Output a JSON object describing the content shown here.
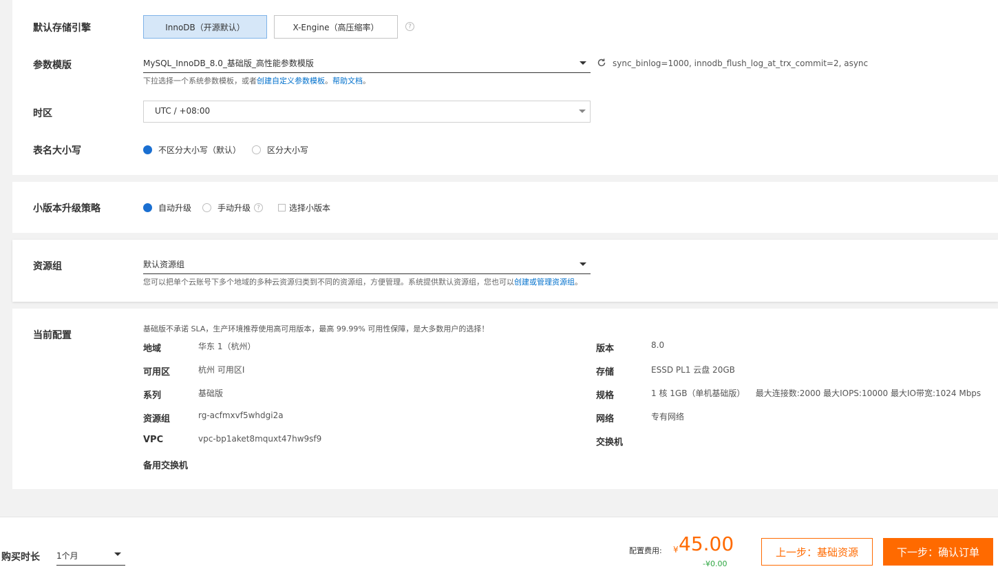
{
  "storage_engine": {
    "label": "默认存储引擎",
    "options": [
      "InnoDB（开源默认）",
      "X-Engine（高压缩率）"
    ],
    "selected": 0
  },
  "param_template": {
    "label": "参数模版",
    "value": "MySQL_InnoDB_8.0_基础版_高性能参数模版",
    "summary": "sync_binlog=1000, innodb_flush_log_at_trx_commit=2, async",
    "hint_prefix": "下拉选择一个系统参数模板，或者",
    "hint_link1": "创建自定义参数模板",
    "hint_sep": "。",
    "hint_link2": "帮助文档",
    "hint_end": "。"
  },
  "timezone": {
    "label": "时区",
    "value": "UTC / +08:00"
  },
  "table_case": {
    "label": "表名大小写",
    "options": [
      "不区分大小写（默认）",
      "区分大小写"
    ],
    "selected": 0
  },
  "minor_upgrade": {
    "label": "小版本升级策略",
    "options": [
      "自动升级",
      "手动升级"
    ],
    "selected": 0,
    "checkbox_label": "选择小版本"
  },
  "resource_group": {
    "label": "资源组",
    "value": "默认资源组",
    "hint_prefix": "您可以把单个云账号下多个地域的多种云资源归类到不同的资源组，方便管理。系统提供默认资源组，您也可以",
    "hint_link": "创建或管理资源组",
    "hint_end": "。"
  },
  "current_config": {
    "label": "当前配置",
    "notice": "基础版不承诺 SLA，生产环境推荐使用高可用版本，最高 99.99% 可用性保障，是大多数用户的选择！",
    "left": [
      {
        "k": "地域",
        "v": "华东 1（杭州）"
      },
      {
        "k": "可用区",
        "v": "杭州 可用区I"
      },
      {
        "k": "系列",
        "v": "基础版"
      },
      {
        "k": "资源组",
        "v": "rg-acfmxvf5whdgi2a"
      },
      {
        "k": "VPC",
        "v": "vpc-bp1aket8mquxt47hw9sf9"
      },
      {
        "k": "备用交换机",
        "v": ""
      }
    ],
    "right": [
      {
        "k": "版本",
        "v": "8.0"
      },
      {
        "k": "存储",
        "v": "ESSD PL1 云盘 20GB"
      },
      {
        "k": "规格",
        "v": "1 核 1GB（单机基础版）    最大连接数:2000 最大IOPS:10000 最大IO带宽:1024 Mbps"
      },
      {
        "k": "网络",
        "v": "专有网络"
      },
      {
        "k": "交换机",
        "v": ""
      }
    ]
  },
  "footer": {
    "duration_label": "购买时长",
    "duration_value": "1个月",
    "fee_label": "配置费用:",
    "currency": "¥",
    "price": "45.00",
    "discount": "-¥0.00",
    "prev_button": "上一步：基础资源",
    "next_button": "下一步：确认订单"
  },
  "colors": {
    "accent_blue": "#1a6fd1",
    "link_blue": "#0070cc",
    "orange": "#ff6a00",
    "green": "#2da641"
  }
}
